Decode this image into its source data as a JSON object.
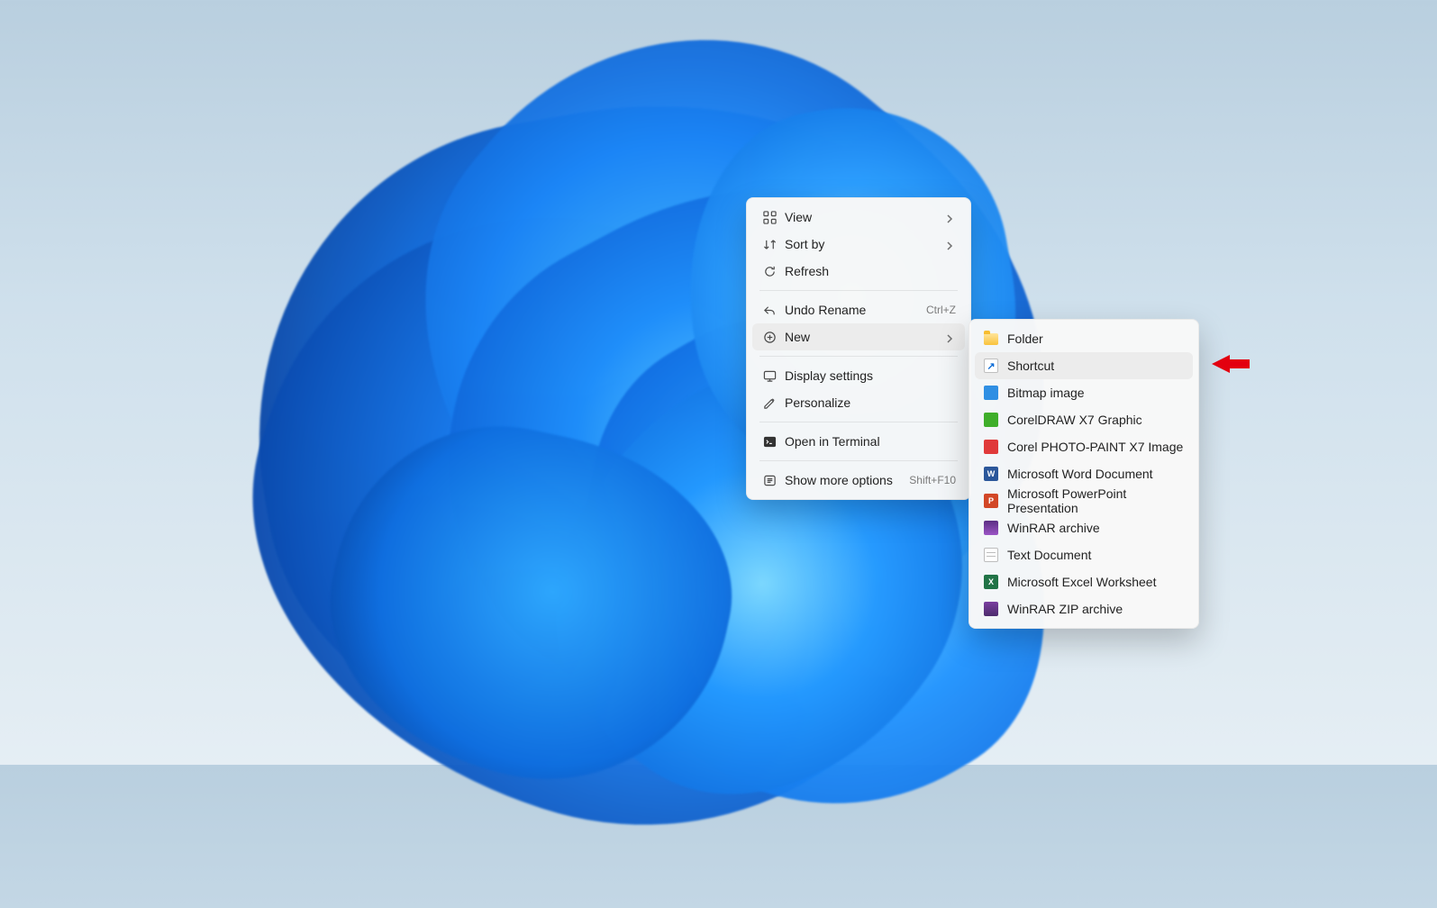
{
  "context_menu": {
    "groups": [
      [
        {
          "id": "view",
          "icon": "grid-icon",
          "label": "View",
          "submenu": true
        },
        {
          "id": "sort",
          "icon": "sort-icon",
          "label": "Sort by",
          "submenu": true
        },
        {
          "id": "refresh",
          "icon": "refresh-icon",
          "label": "Refresh"
        }
      ],
      [
        {
          "id": "undo-rename",
          "icon": "undo-icon",
          "label": "Undo Rename",
          "shortcut": "Ctrl+Z"
        },
        {
          "id": "new",
          "icon": "new-icon",
          "label": "New",
          "submenu": true,
          "hover": true
        }
      ],
      [
        {
          "id": "display-settings",
          "icon": "display-icon",
          "label": "Display settings"
        },
        {
          "id": "personalize",
          "icon": "personalize-icon",
          "label": "Personalize"
        }
      ],
      [
        {
          "id": "open-terminal",
          "icon": "terminal-icon",
          "label": "Open in Terminal"
        }
      ],
      [
        {
          "id": "more-options",
          "icon": "more-icon",
          "label": "Show more options",
          "shortcut": "Shift+F10"
        }
      ]
    ]
  },
  "new_submenu": {
    "items": [
      {
        "id": "folder",
        "icon": "folder-icon",
        "label": "Folder"
      },
      {
        "id": "shortcut",
        "icon": "shortcut-icon",
        "label": "Shortcut",
        "hover": true
      },
      {
        "id": "bitmap",
        "icon": "bmp-icon",
        "label": "Bitmap image"
      },
      {
        "id": "cdr",
        "icon": "cdr-icon",
        "label": "CorelDRAW X7 Graphic"
      },
      {
        "id": "cpt",
        "icon": "cpt-icon",
        "label": "Corel PHOTO-PAINT X7 Image"
      },
      {
        "id": "docx",
        "icon": "docx-icon",
        "label": "Microsoft Word Document"
      },
      {
        "id": "pptx",
        "icon": "pptx-icon",
        "label": "Microsoft PowerPoint Presentation"
      },
      {
        "id": "rar",
        "icon": "rar-icon",
        "label": "WinRAR archive"
      },
      {
        "id": "txt",
        "icon": "txt-icon",
        "label": "Text Document"
      },
      {
        "id": "xlsx",
        "icon": "xlsx-icon",
        "label": "Microsoft Excel Worksheet"
      },
      {
        "id": "zip",
        "icon": "zip-icon",
        "label": "WinRAR ZIP archive"
      }
    ]
  },
  "annotation": {
    "arrow_target": "shortcut"
  }
}
